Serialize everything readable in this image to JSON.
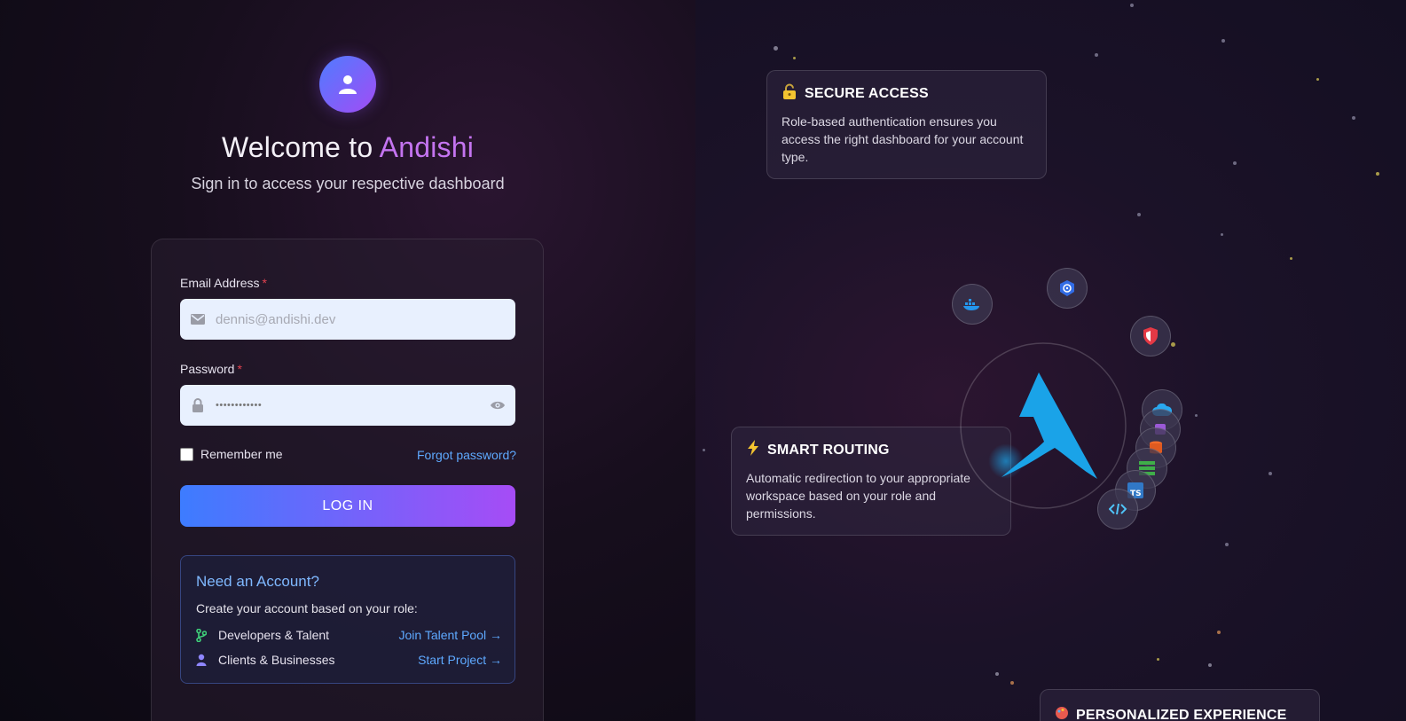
{
  "header": {
    "title_prefix": "Welcome to ",
    "title_brand": "Andishi",
    "subtitle": "Sign in to access your respective dashboard"
  },
  "form": {
    "email_label": "Email Address",
    "required_mark": "*",
    "email_placeholder": "dennis@andishi.dev",
    "password_label": "Password",
    "password_value": "••••••••••••",
    "remember_label": "Remember me",
    "forgot_label": "Forgot password?",
    "login_label": "LOG IN"
  },
  "account": {
    "title": "Need an Account?",
    "description": "Create your account based on your role:",
    "rows": [
      {
        "label": "Developers & Talent",
        "link": "Join Talent Pool →",
        "icon": "branch-icon"
      },
      {
        "label": "Clients & Businesses",
        "link": "Start Project →",
        "icon": "user-icon"
      }
    ]
  },
  "features": [
    {
      "title": "SECURE ACCESS",
      "icon": "lock-icon",
      "description": "Role-based authentication ensures you access the right dashboard for your account type."
    },
    {
      "title": "SMART ROUTING",
      "icon": "lightning-icon",
      "description": "Automatic redirection to your appropriate workspace based on your role and permissions."
    },
    {
      "title": "PERSONALIZED EXPERIENCE",
      "icon": "palette-icon",
      "description": ""
    }
  ],
  "orbit_icons": [
    "docker-icon",
    "kubernetes-icon",
    "shield-icon",
    "cloud-icon",
    "database-icon",
    "server-icon",
    "typescript-icon",
    "code-icon"
  ],
  "colors": {
    "brand_purple": "#c474f0",
    "link_blue": "#5ea9ff",
    "button_start": "#3d7cff",
    "button_end": "#a64cf6",
    "logo_blue": "#1aa3e8"
  }
}
